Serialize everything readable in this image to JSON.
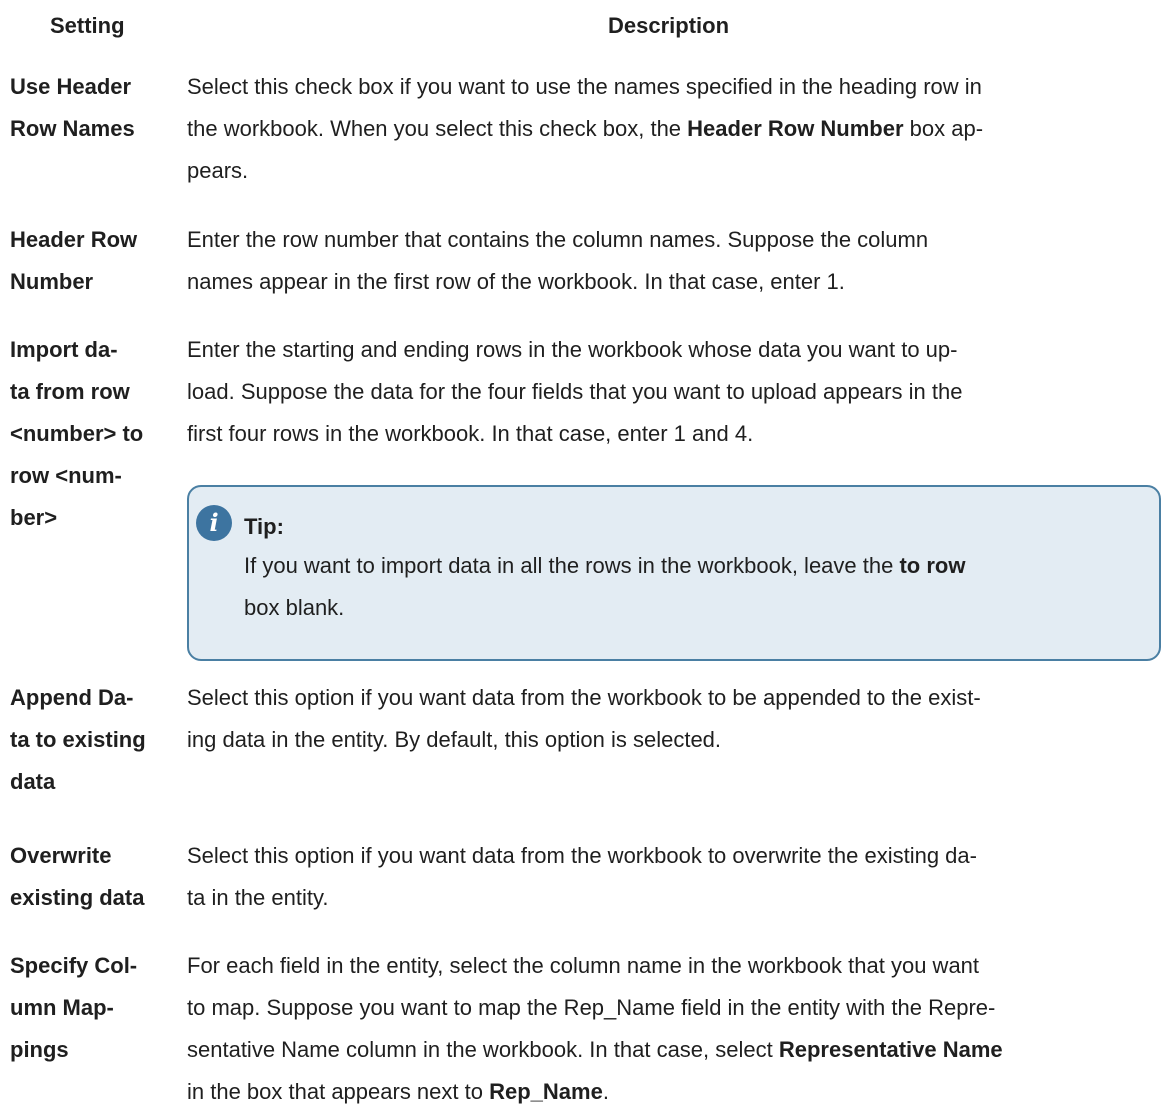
{
  "headers": {
    "setting": "Setting",
    "description": "Description"
  },
  "rows": [
    {
      "setting": [
        "Use Header",
        "Row Names"
      ],
      "description": [
        [
          {
            "t": "Select this check box if you want to use the names specified in the heading row in"
          }
        ],
        [
          {
            "t": "the workbook. When you select this check box, the "
          },
          {
            "t": "Header Row Number",
            "b": true
          },
          {
            "t": " box ap-"
          }
        ],
        [
          {
            "t": "pears."
          }
        ]
      ]
    },
    {
      "setting": [
        "Header Row",
        "Number"
      ],
      "description": [
        [
          {
            "t": "Enter the row number that contains the column names. Suppose the column"
          }
        ],
        [
          {
            "t": "names appear in the first row of the workbook. In that case, enter 1."
          }
        ]
      ]
    },
    {
      "setting": [
        "Import da-",
        "ta from row",
        "<number> to",
        "row <num-",
        "ber>"
      ],
      "description": [
        [
          {
            "t": "Enter the starting and ending rows in the workbook whose data you want to up-"
          }
        ],
        [
          {
            "t": "load. Suppose the data for the four fields that you want to upload appears in the"
          }
        ],
        [
          {
            "t": "first four rows in the workbook. In that case, enter 1 and 4."
          }
        ]
      ],
      "tip": {
        "icon": "info-icon",
        "title": "Tip:",
        "lines": [
          [
            {
              "t": "If you want to import data in all the rows in the workbook, leave the "
            },
            {
              "t": "to row",
              "b": true
            }
          ],
          [
            {
              "t": "box blank."
            }
          ]
        ]
      }
    },
    {
      "setting": [
        "Append Da-",
        "ta to existing",
        "data"
      ],
      "description": [
        [
          {
            "t": "Select this option if you want data from the workbook to be appended to the exist-"
          }
        ],
        [
          {
            "t": "ing data in the entity. By default, this option is selected."
          }
        ]
      ]
    },
    {
      "setting": [
        "Overwrite",
        "existing data"
      ],
      "description": [
        [
          {
            "t": "Select this option if you want data from the workbook to overwrite the existing da-"
          }
        ],
        [
          {
            "t": "ta in the entity."
          }
        ]
      ]
    },
    {
      "setting": [
        "Specify Col-",
        "umn Map-",
        "pings"
      ],
      "description": [
        [
          {
            "t": "For each field in the entity, select the column name in the workbook that you want"
          }
        ],
        [
          {
            "t": "to map. Suppose you want to map the Rep_Name field in the entity with the Repre-"
          }
        ],
        [
          {
            "t": "sentative Name column in the workbook. In that case, select "
          },
          {
            "t": "Representative Name",
            "b": true
          }
        ],
        [
          {
            "t": "in the box that appears next to "
          },
          {
            "t": "Rep_Name",
            "b": true
          },
          {
            "t": "."
          }
        ]
      ]
    }
  ]
}
